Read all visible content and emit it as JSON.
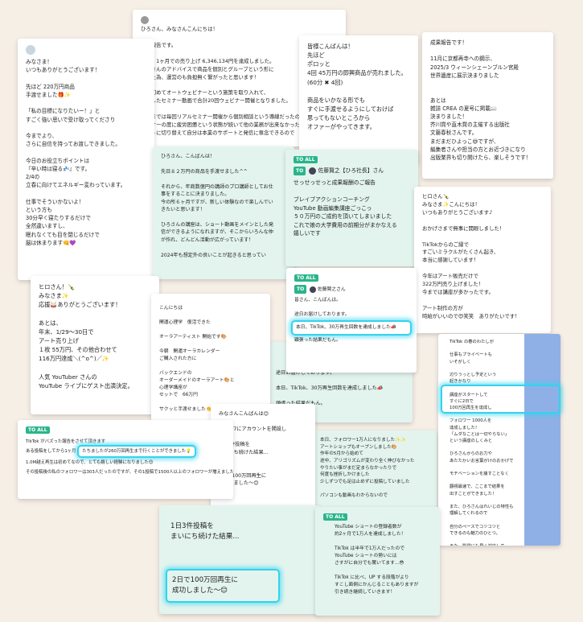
{
  "cards": {
    "a": {
      "header": "みなさま！",
      "lines": [
        "いつもありがとうございます！",
        "",
        "先ほど 220万円商品",
        "手渡せました🎁✨",
        "",
        "「私の目標になりたいー！」と",
        "すごく強い思いで受け取ってくださり",
        "",
        "今までより、",
        "さらに自信を持ってお渡しできました。",
        "",
        "今日のお役立ちポイントは",
        "『辛い時は寝る💤』です。",
        "2/4の",
        "立春に向けてエネルギー変わっています。",
        "",
        "仕事でそういかないよ！",
        "という方も",
        "30分早く寝たりするだけで",
        "全然違いますし、",
        "眠れなくても目を閉じるだけで",
        "脳は休まります👊💜"
      ]
    },
    "b": {
      "lines": [
        "ひろさん、みなさんこんにちは！",
        "",
        "成果報告です。",
        "",
        "直近、1ヶ月での売り上げ 6,346,134円を達成しました。",
        "ひろさんのアドバイスで商品を個別とグループという形に",
        "分けた為、運営のも負担無く繋がったと思います！",
        "",
        "今回初めてオートウェビナーという施策を取り入れて、",
        "録画したセミナー動画で合計20回ウェビナー開催となりました。",
        "",
        "これまでは毎回リアルセミナー開催から個別相談という導線だったので",
        "セミナーの度に疲労困憊という状態が続いて他の業務が出来なかったので、",
        "オートに切り替えて自分は本業のサポートと発信に専念できるので"
      ]
    },
    "c": {
      "lines": [
        "皆様こんばんは！",
        "先ほど",
        "ポロッと",
        "4回 45万円の即興商品が売れました。",
        "(60分 ✖ 4回)",
        "",
        "商品をいかなる形でも",
        "すぐに手渡せるようにしておけば",
        "思ってもないところから",
        "オファーがやってきます。"
      ]
    },
    "d": {
      "lines": [
        "成果報告です！",
        "",
        "11月に京都再寺への鋼示、",
        "2025/3 ウィーンシェーンブルン宮殿",
        "世界遺産に展示決まりました",
        "",
        "",
        "あとは",
        "雑誌 CREA の夏号に掲載📖",
        "決まりました！",
        "芥川賞や直木賞の主催する出版社",
        "文藝春秋さんです。",
        "まだまだひよっこ😅ですが、",
        "編集者さんや担当の方とお近づきになり",
        "出版業界も切り開けたら、楽しそうです！"
      ]
    },
    "e": {
      "lines": [
        "ひろさん、こんばんは！",
        "",
        "先日８２万円の商品を手渡せました^^",
        "",
        "それから、年商数億円の講師のプロ講師としてお仕",
        "事をすることに決まりました。",
        "今の所６ヶ月ですが、新しい体験なので楽しんでい",
        "きたいと思います！",
        "",
        "ひろさんの講座は、ショート動画をメインとした発",
        "信ができるようになれますが、そこからいろんな仲",
        "が作れ、どんどん活動が広がっています！",
        "",
        "2024年も想定外の良いことが起きると思ってい"
      ]
    },
    "f": {
      "tag": "TO ALL",
      "to": "TO",
      "name": "佐藤賢之【ひろ社長】さん",
      "lines": [
        "せっせっせっと成果報酬のご報告",
        "",
        "ブレイブアクションコーチング",
        "YouTube 動画編集講座ごっこっ",
        "５０万円のご成約を頂いてしまいました",
        "これで娘の大学費用の前期分がまかなえる",
        "嬉しいです"
      ]
    },
    "g": {
      "lines": [
        "ヒロさん🍾",
        "みなさま✨こんにちは！",
        "いつもありがとうございます♪",
        "",
        "おかげさまで無事に開眼しました！",
        "",
        "TikTokからのご縁で",
        "すごいミラクルがたくさん起き、",
        "本当に感謝しています！",
        "",
        "今年はアート販売だけで",
        "322万円売り上げました！",
        "今までは講座が多かったです。",
        "",
        "アート制作の方が",
        "時給がいいので😍笑笑　ありがたいです！"
      ]
    },
    "h": {
      "lines": [
        "ヒロさん！🍾",
        "みなさま✨",
        "応援🥁ありがとうございます！",
        "",
        "あとは、",
        "年末、1/29～30日で",
        "アート売り上げ",
        "１枚 55万円、その他合わせて",
        "116万円達成＼(^o^)／✨",
        "",
        "人気 YouTuber さんの",
        "YouTube ライブにゲスト出演決定。"
      ]
    },
    "i": {
      "lines": [
        "こんにちは",
        "",
        "開運心理学　復活できた",
        "",
        "オーラアーティスト 開始です🎨",
        "",
        "今朝　開運オーラカレンダー",
        "ご購入された方に",
        "",
        "バックエンドの",
        "オーダーメイドのオーラアート🎨と",
        "心理学講座が",
        "セットで　66万円",
        "",
        "サクッと手渡せました👏"
      ]
    },
    "j": {
      "tag": "TO ALL",
      "to": "TO",
      "name": "佐藤賢之さん",
      "intro": [
        "皆さん、こんばんは。",
        "",
        "途日お届けしております。"
      ],
      "hl": "本日、TikTok、30万再生回数を達成しました📣",
      "lines2": [
        "顕張った結果だもん。"
      ]
    },
    "k": {
      "lines": [
        "途日お届けしております。",
        "",
        "本日、TikTok、30万再生回数を達成しました📣",
        "",
        "頑張った結果だもん。"
      ]
    },
    "l": {
      "lines": [
        "本日、フォロワー1万人になりました✨✨",
        "アートショップもオープンしました🎨",
        "作年の5月から始めて",
        "途中、アリゴリズムが変わり全く伸びなかった",
        "やりたい事がまだ定まらなかったりで",
        "何度も挫折しかけました",
        "少しずつでも足は止めずに投稿していました",
        "",
        "パソコンも動画もわからないので"
      ]
    },
    "m": {
      "lines": [
        "TikTok の春のわたしが",
        "",
        "仕事もプライベートも",
        "いそがしく",
        "",
        "辺りうっとし予定という",
        "起きかなり",
        "",
        "講座がスタートして",
        "すぐに2日で",
        "100万回再生を達成し",
        "",
        "フォロワー 1000人を",
        "達成しました！",
        "「ムダなことは一切やらない」",
        "という講座のしくみと",
        "",
        "ひろさんからのお力や",
        "あたたかいお言葉がけのおかげで",
        "",
        "モチベーションを崩すことなく",
        "",
        "翻視最速で、ここまで結果を",
        "出すことができました！",
        "",
        "また、ひろさんはれいじの特性も",
        "理解してくれるので",
        "",
        "自分のペースでコツコツと",
        "できるのも魅力のひとつ。",
        "",
        "また、質問にも早く対応して",
        "くださるのも有り難いです！"
      ]
    },
    "n": {
      "tag": "TO ALL",
      "line1": "TikTok がバズった報告をさせて頂きます",
      "pre": "ある投稿をしてから1ヶ月",
      "hl": "たちましたが260万回再生まで行くことができました💡",
      "post": "1.0M越え再生は初めてなので、とても嬉しい経験になりました😊",
      "line4": "その投稿後の私のフォロワーは303人だったのですが、その1投稿で1500人以上のフォロワーが増えました！"
    },
    "o": {
      "lines": [
        "みなさんこんばんは😊",
        "",
        "先月5/7にアカウントを開設し",
        "",
        "1日3件投稿を",
        "まいにち続けた結果...",
        "",
        "",
        "2日で100万回再生に",
        "成功しました〜😊"
      ]
    },
    "p": {
      "lines": [
        "1日3件投稿を",
        "まいにち続けた結果..."
      ],
      "hl": [
        "2日で100万回再生に",
        "成功しました〜😊"
      ]
    },
    "q": {
      "tag": "TO ALL",
      "lines": [
        "YouTube ショートの登録者数が",
        "約2ヶ月で1万人を達成しました！",
        "",
        "TikTok は半年で1万人だったので",
        "YouTube ショートの勢いには",
        "さすがに自分でも驚いてます...😳",
        "",
        "TikTok に比べ、UP する段階がより",
        "すこし面倒にかんじることもありますが",
        "引き続き継続していきます！"
      ]
    }
  }
}
